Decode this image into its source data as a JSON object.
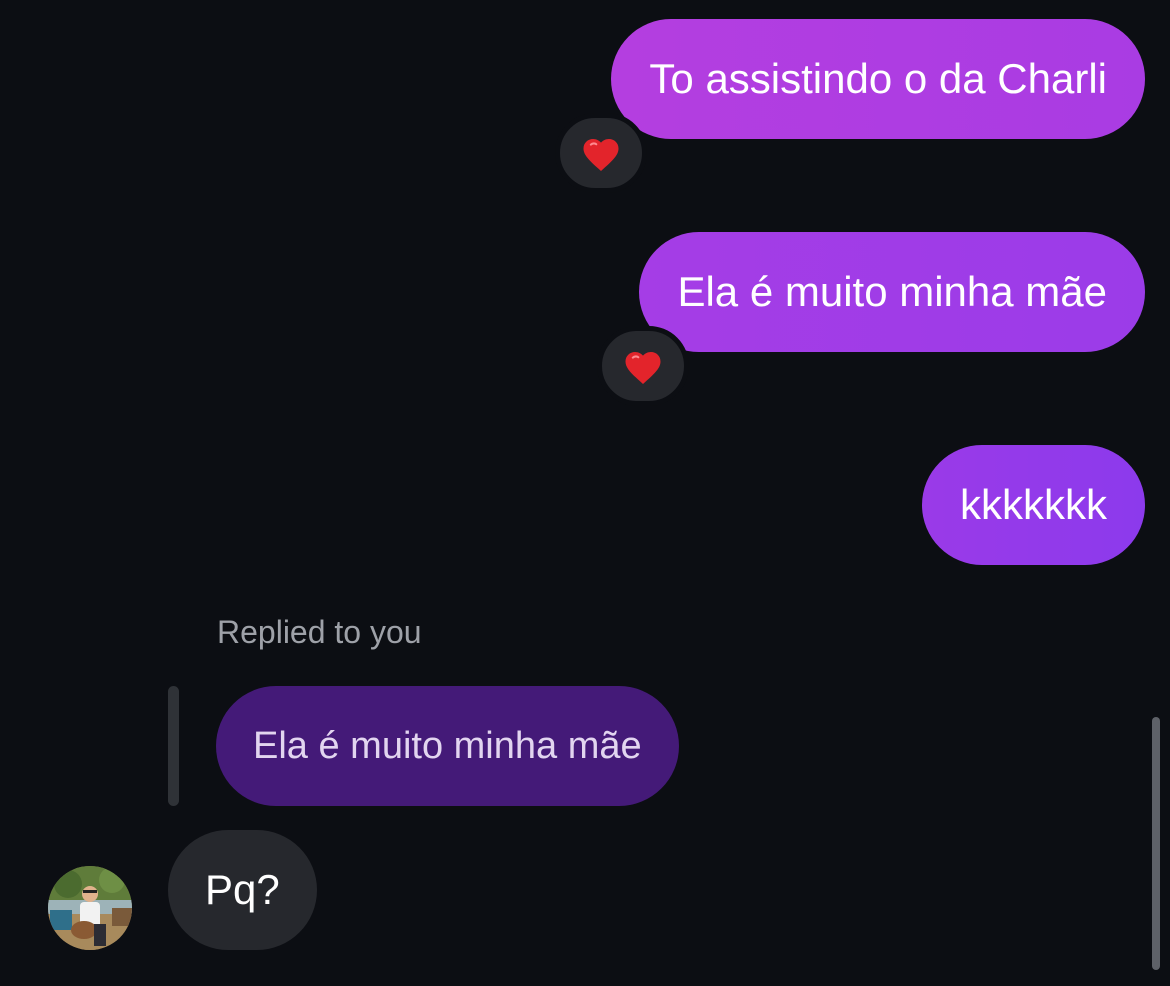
{
  "messages": {
    "out_1": {
      "text": "To assistindo o da Charli",
      "reaction": "heart"
    },
    "out_2": {
      "text": "Ela é muito minha mãe",
      "reaction": "heart"
    },
    "out_3": {
      "text": "kkkkkkk"
    }
  },
  "reply": {
    "label": "Replied to you",
    "quoted_text": "Ela é muito minha mãe",
    "text": "Pq?"
  },
  "colors": {
    "background": "#0c0e13",
    "outgoing_start": "#b43ee0",
    "outgoing_end": "#8c3aec",
    "quoted_bubble": "#441a78",
    "incoming_bubble": "#26282d",
    "reaction_heart": "#e3242b"
  },
  "icons": {
    "reaction": "heart-icon",
    "avatar": "user-avatar"
  }
}
